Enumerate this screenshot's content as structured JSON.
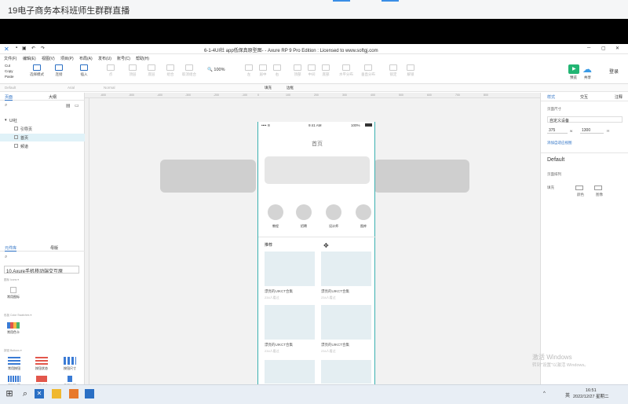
{
  "stream_title": "19电子商务本科班师生群群直播",
  "window": {
    "title": "6-1-4UI社 app低保真原型图- - Axure RP 9 Pro Edition : Licensed to www.softgj.com",
    "controls": [
      "─",
      "▢",
      "✕"
    ]
  },
  "menu": [
    "文件(F)",
    "编辑(E)",
    "视图(V)",
    "项目(P)",
    "布局(A)",
    "发布(U)",
    "账号(C)",
    "帮助(H)"
  ],
  "clipboard": [
    "Cut",
    "Copy",
    "Paste"
  ],
  "toolbar": {
    "buttons": [
      {
        "label": "选择模式",
        "active": true
      },
      {
        "label": "连接",
        "active": true
      },
      {
        "label": "插入",
        "active": true
      },
      {
        "label": "点",
        "active": false
      },
      {
        "label": "顶层",
        "active": false
      },
      {
        "label": "底层",
        "active": false
      },
      {
        "label": "组合",
        "active": false
      },
      {
        "label": "取消组合",
        "active": false
      }
    ],
    "zoom": "100%",
    "right_buttons": [
      {
        "label": "左",
        "active": false
      },
      {
        "label": "居中",
        "active": false
      },
      {
        "label": "右",
        "active": false
      },
      {
        "label": "顶部",
        "active": false
      },
      {
        "label": "中间",
        "active": false
      },
      {
        "label": "底部",
        "active": false
      },
      {
        "label": "水平分布",
        "active": false
      },
      {
        "label": "垂直分布",
        "active": false
      },
      {
        "label": "锁定",
        "active": false
      },
      {
        "label": "解锁",
        "active": false
      }
    ],
    "preview": "预览",
    "share": "共享",
    "login": "登录"
  },
  "stylebar": [
    "Default",
    "Arial",
    "Normal",
    "填充",
    "边框"
  ],
  "left_panel": {
    "tabs": [
      "页面",
      "大纲"
    ],
    "pages": [
      {
        "label": "UI社",
        "selected": false,
        "indent": 0
      },
      {
        "label": "引导页",
        "selected": false,
        "indent": 1
      },
      {
        "label": "首页",
        "selected": true,
        "indent": 1
      },
      {
        "label": "频道",
        "selected": false,
        "indent": 1
      }
    ],
    "lib_tabs": [
      "元件库",
      "母版"
    ],
    "library_name": "10.Axure手机移动端交互原",
    "sections": [
      {
        "title": "图标 Icons ▾",
        "items": [
          "常用图标"
        ]
      },
      {
        "title": "色板 Color Swatches ▾",
        "items": [
          "常用色卡"
        ]
      },
      {
        "title": "按钮 Buttons ▾",
        "items": [
          "常用按钮",
          "按钮状态",
          "按钮尺寸",
          "图形按钮",
          "按钮组合",
          "悬浮按钮",
          "常用导航"
        ]
      }
    ]
  },
  "ruler_marks": [
    "-600",
    "-500",
    "-400",
    "-300",
    "-200",
    "-100",
    "0",
    "100",
    "200",
    "300",
    "400",
    "500",
    "600",
    "700",
    "800"
  ],
  "canvas": {
    "status_time": "9:41 AM",
    "status_battery": "100%",
    "page_title": "首页",
    "categories": [
      "教程",
      "招聘",
      "设计师",
      "图库"
    ],
    "recommend_header": "推荐",
    "cards": [
      {
        "title": "漂亮的UIKCT合集",
        "sub": "234人看过"
      },
      {
        "title": "漂亮的UIKCT合集",
        "sub": "234人看过"
      },
      {
        "title": "漂亮的UIKCT合集",
        "sub": "234人看过"
      },
      {
        "title": "漂亮的UIKCT合集",
        "sub": "234人看过"
      }
    ]
  },
  "right_panel": {
    "tabs": [
      "样式",
      "交互",
      "注释"
    ],
    "page_size_label": "页面尺寸",
    "device": "自定义设备",
    "width": "375",
    "height": "1300",
    "add_guides": "添加自适应视图",
    "style_name": "Default",
    "page_align": "页面排列",
    "fill_label": "填充",
    "fill_color": "颜色",
    "fill_image": "图像"
  },
  "taskbar": {
    "tray": "英",
    "time": "16:51",
    "date": "2022/12/27 星期二"
  },
  "watermark": {
    "line1": "激活 Windows",
    "line2": "转到\"设置\"以激活 Windows。"
  }
}
